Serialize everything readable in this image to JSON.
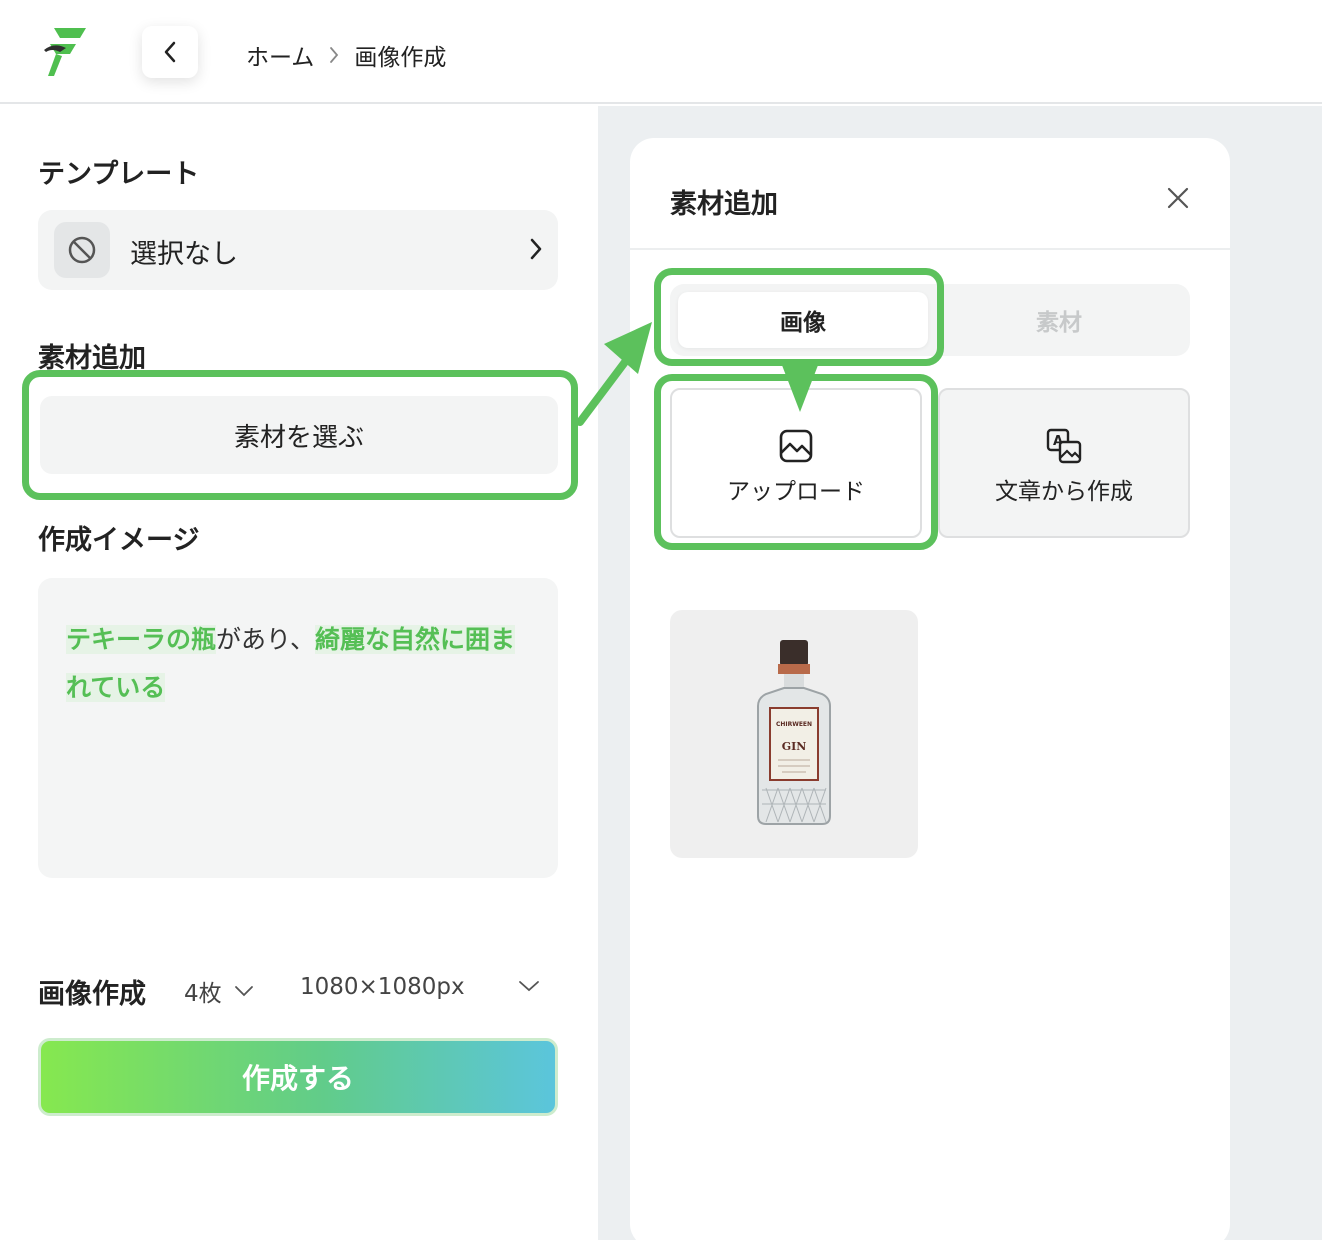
{
  "header": {
    "breadcrumb": [
      "ホーム",
      "画像作成"
    ]
  },
  "left": {
    "template_title": "テンプレート",
    "template_value": "選択なし",
    "material_title": "素材追加",
    "material_button": "素材を選ぶ",
    "image_title": "作成イメージ",
    "image_prompt": [
      {
        "text": "テキーラの瓶",
        "highlight": true
      },
      {
        "text": "があり、",
        "highlight": false
      },
      {
        "text": "綺麗な自然に囲まれている",
        "highlight": true
      }
    ],
    "generate_label": "画像作成",
    "count_value": "4枚",
    "size_value": "1080×1080px",
    "create_button": "作成する"
  },
  "panel": {
    "title": "素材追加",
    "tabs": [
      {
        "label": "画像",
        "active": true
      },
      {
        "label": "素材",
        "active": false
      }
    ],
    "upload_label": "アップロード",
    "generate_from_text_label": "文章から作成",
    "thumbnail": {
      "bottle_label_top": "CHIRWEEN",
      "bottle_label_main": "GIN"
    }
  },
  "colors": {
    "accent_green": "#5cc15c",
    "highlight_green": "#55bf55",
    "gradient_start": "#86e84f",
    "gradient_end": "#5bc5dc"
  }
}
